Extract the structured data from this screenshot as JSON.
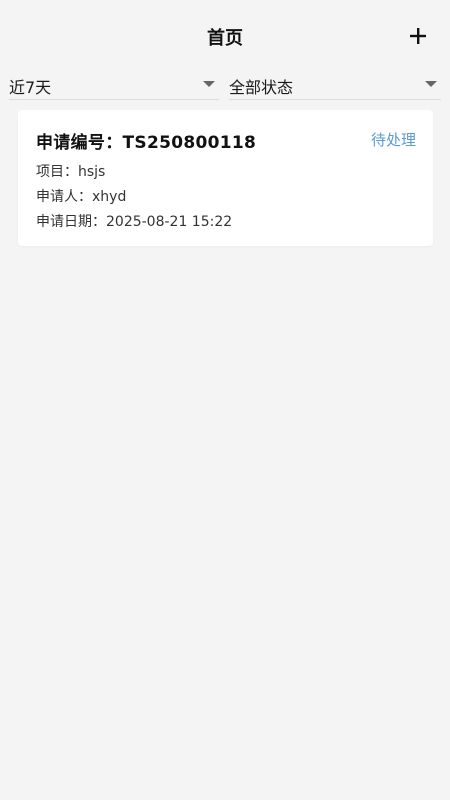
{
  "header": {
    "title": "首页",
    "add_icon": "plus-icon"
  },
  "filters": {
    "date_range": {
      "selected": "近7天",
      "icon": "triangle-down-icon"
    },
    "status": {
      "selected": "全部状态",
      "icon": "triangle-down-icon"
    }
  },
  "requests": [
    {
      "number_label": "申请编号：",
      "number": "TS250800118",
      "status": "待处理",
      "project_label": "项目：",
      "project": "hsjs",
      "applicant_label": "申请人：",
      "applicant": "xhyd",
      "date_label": "申请日期：",
      "date": "2025-08-21 15:22"
    }
  ],
  "colors": {
    "background": "#f4f4f4",
    "card": "#ffffff",
    "status_pending": "#5b9bd5",
    "text": "#1a1a1a"
  }
}
